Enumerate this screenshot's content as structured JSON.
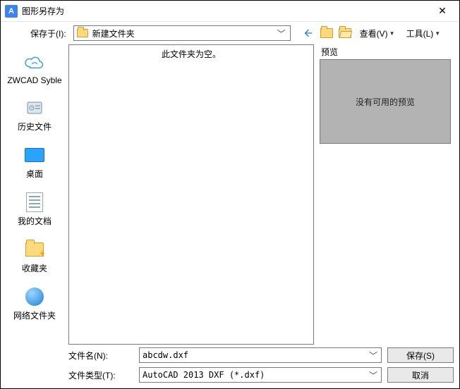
{
  "window": {
    "title": "图形另存为"
  },
  "toolbar": {
    "save_in_label": "保存于(I):",
    "current_folder": "新建文件夹",
    "view_label": "查看(V)",
    "tools_label": "工具(L)"
  },
  "sidebar": {
    "items": [
      {
        "label": "ZWCAD Syble",
        "icon": "cloud"
      },
      {
        "label": "历史文件",
        "icon": "history"
      },
      {
        "label": "桌面",
        "icon": "desktop"
      },
      {
        "label": "我的文档",
        "icon": "docs"
      },
      {
        "label": "收藏夹",
        "icon": "folder-star"
      },
      {
        "label": "网络文件夹",
        "icon": "globe"
      }
    ]
  },
  "file_list": {
    "empty_message": "此文件夹为空。"
  },
  "preview": {
    "label": "预览",
    "no_preview": "没有可用的预览"
  },
  "form": {
    "filename_label": "文件名(N):",
    "filename_value": "abcdw.dxf",
    "filetype_label": "文件类型(T):",
    "filetype_value": "AutoCAD 2013 DXF (*.dxf)",
    "save_button": "保存(S)",
    "cancel_button": "取消"
  }
}
